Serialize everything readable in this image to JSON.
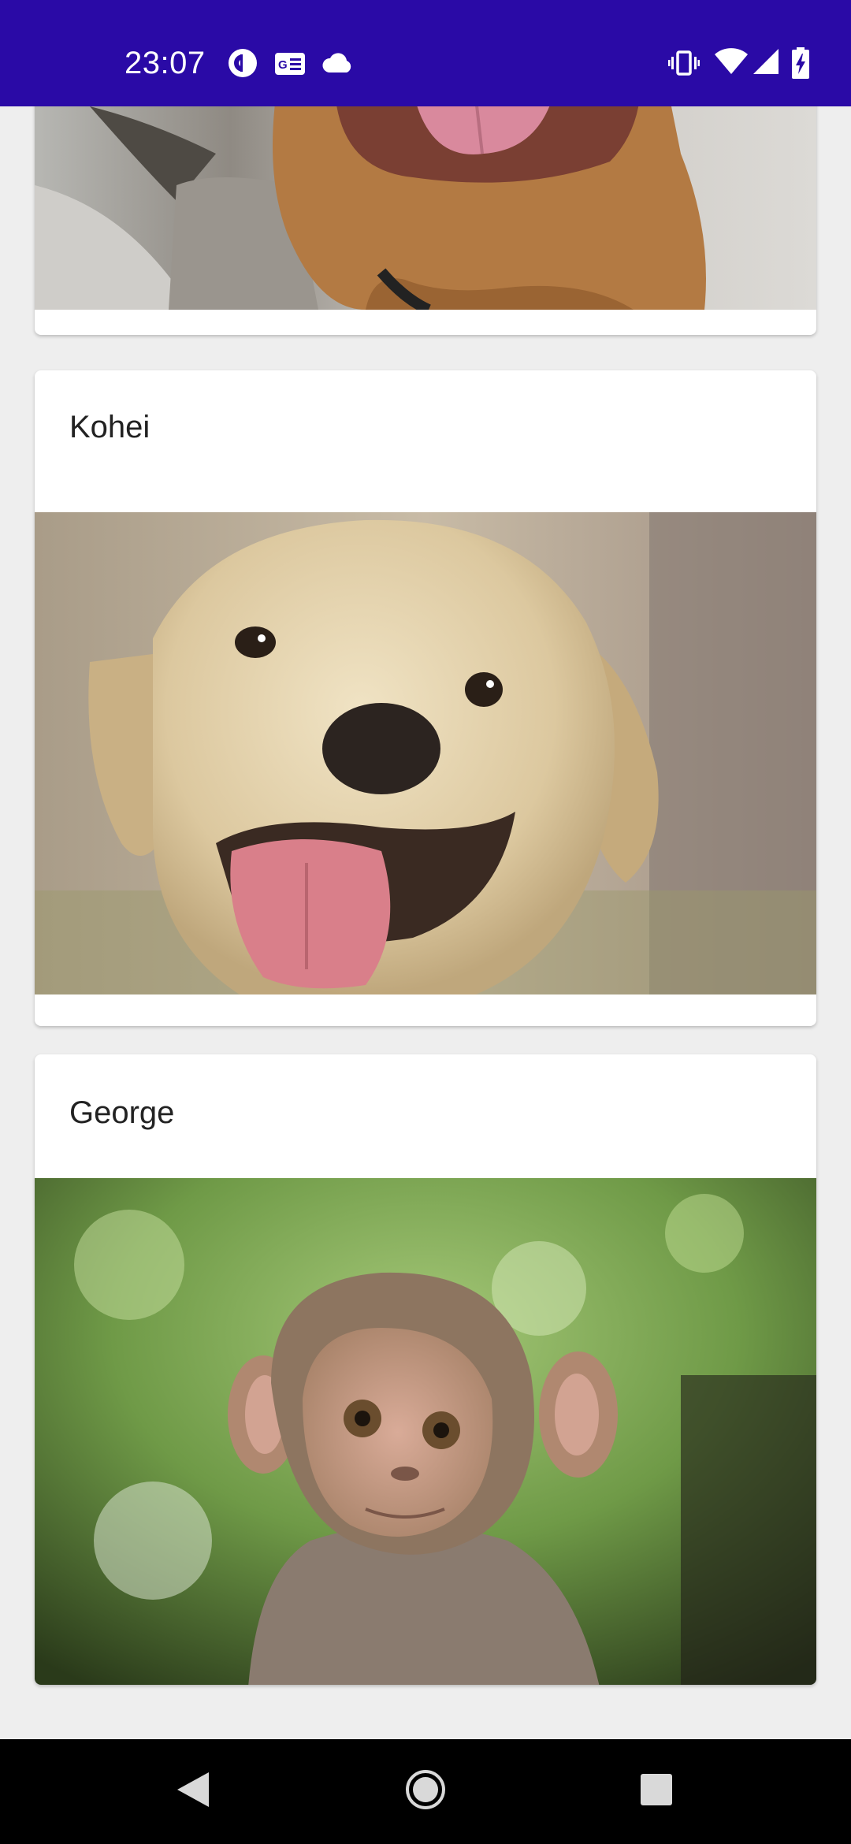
{
  "status_bar": {
    "time": "23:07",
    "left_icons": [
      "pocket-casts-icon",
      "news-icon",
      "cloud-icon"
    ],
    "right_icons": [
      "vibrate-icon",
      "wifi-icon",
      "signal-icon",
      "battery-charging-icon"
    ]
  },
  "cards": [
    {
      "title": "",
      "image": "brown-dog-photo"
    },
    {
      "title": "Kohei",
      "image": "labrador-puppy-photo"
    },
    {
      "title": "George",
      "image": "baby-monkey-photo"
    }
  ],
  "nav_bar": {
    "buttons": [
      "back-button",
      "home-button",
      "recents-button"
    ]
  },
  "colors": {
    "status_bar": "#2a0aa6",
    "background": "#eeeeee",
    "card": "#ffffff",
    "nav_bar": "#000000"
  }
}
